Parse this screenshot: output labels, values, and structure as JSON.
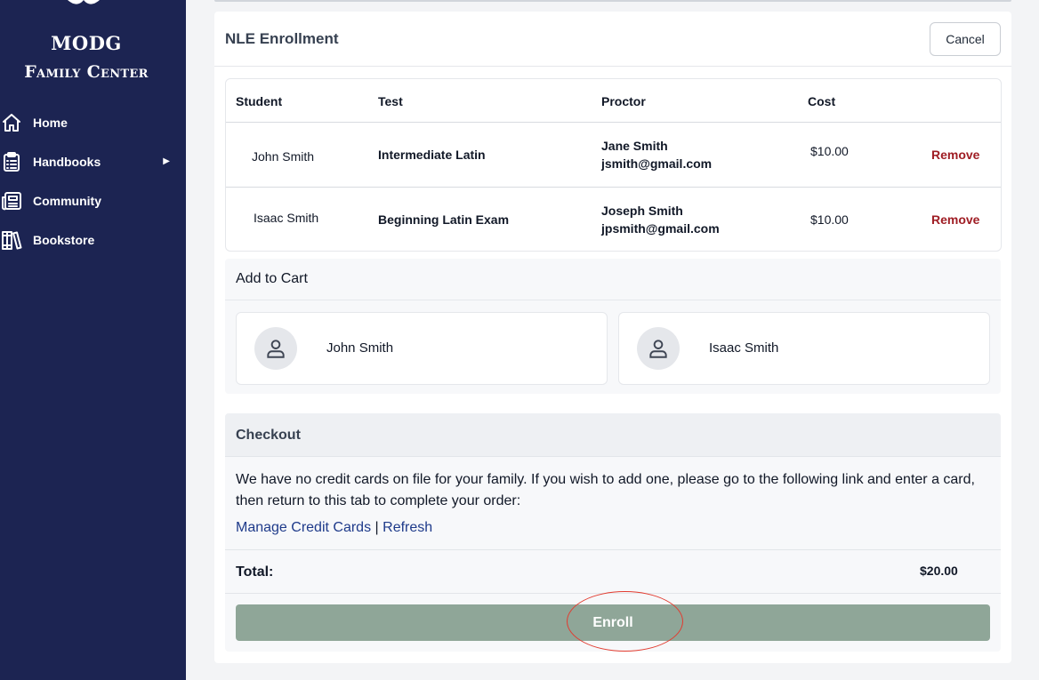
{
  "sidebar": {
    "brand_line1": "MODG",
    "brand_line2": "Family Center",
    "items": [
      {
        "label": "Home",
        "icon": "home-icon"
      },
      {
        "label": "Handbooks",
        "icon": "clipboard-list-icon",
        "has_submenu": true
      },
      {
        "label": "Community",
        "icon": "newspaper-icon"
      },
      {
        "label": "Bookstore",
        "icon": "books-icon"
      }
    ],
    "submenu_caret": "▶"
  },
  "header": {
    "title": "NLE Enrollment",
    "cancel_label": "Cancel"
  },
  "enrollment_table": {
    "columns": [
      "Student",
      "Test",
      "Proctor",
      "Cost"
    ],
    "rows": [
      {
        "student": "John Smith",
        "test": "Intermediate Latin",
        "proctor_name": "Jane Smith",
        "proctor_email": "jsmith@gmail.com",
        "cost": "$10.00",
        "action": "Remove"
      },
      {
        "student": "Isaac Smith",
        "test": "Beginning Latin Exam",
        "proctor_name": "Joseph Smith",
        "proctor_email": "jpsmith@gmail.com",
        "cost": "$10.00",
        "action": "Remove"
      }
    ]
  },
  "add_to_cart": {
    "title": "Add to Cart",
    "students": [
      {
        "name": "John Smith",
        "icon": "user-icon"
      },
      {
        "name": "Isaac Smith",
        "icon": "user-icon"
      }
    ]
  },
  "checkout": {
    "title": "Checkout",
    "message": "We have no credit cards on file for your family. If you wish to add one, please go to the following link and enter a card, then return to this tab to complete your order:",
    "manage_cards_link": "Manage Credit Cards",
    "separator": "|",
    "refresh_link": "Refresh",
    "total_label": "Total:",
    "total_value": "$20.00",
    "enroll_label": "Enroll"
  },
  "colors": {
    "sidebar_bg": "#1c2452",
    "enroll_button": "#8fa698",
    "remove_link": "#9f1d24",
    "link": "#1e3a8a",
    "annotation": "#e23b2f"
  }
}
